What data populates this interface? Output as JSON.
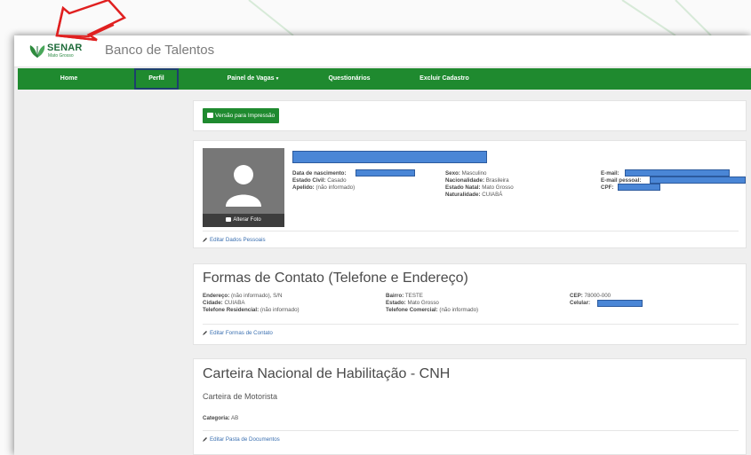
{
  "app": {
    "logo_text": "SENAR",
    "logo_sub": "Mato Grosso",
    "title": "Banco de Talentos"
  },
  "nav": {
    "items": [
      {
        "label": "Home"
      },
      {
        "label": "Perfil"
      },
      {
        "label": "Painel de Vagas"
      },
      {
        "label": "Questionários"
      },
      {
        "label": "Excluir Cadastro"
      }
    ]
  },
  "print": {
    "label": "Versão para Impressão"
  },
  "personal": {
    "photo_button": "Alterar Foto",
    "col1": [
      {
        "label": "Data de nascimento:",
        "value": ""
      },
      {
        "label": "Estado Civil:",
        "value": "Casado"
      },
      {
        "label": "Apelido:",
        "value": "(não informado)"
      }
    ],
    "col2": [
      {
        "label": "Sexo:",
        "value": "Masculino"
      },
      {
        "label": "Nacionalidade:",
        "value": "Brasileira"
      },
      {
        "label": "Estado Natal:",
        "value": "Mato Grosso"
      },
      {
        "label": "Naturalidade:",
        "value": "CUIABÁ"
      }
    ],
    "col3": [
      {
        "label": "E-mail:",
        "value": ""
      },
      {
        "label": "E-mail pessoal:",
        "value": ""
      },
      {
        "label": "CPF:",
        "value": ""
      }
    ],
    "edit_label": "Editar Dados Pessoais"
  },
  "contact": {
    "title": "Formas de Contato (Telefone e Endereço)",
    "col1": [
      {
        "label": "Endereço:",
        "value": "(não informado), S/N"
      },
      {
        "label": "Cidade:",
        "value": "CUIABA"
      },
      {
        "label": "Telefone Residencial:",
        "value": "(não informado)"
      }
    ],
    "col2": [
      {
        "label": "Bairro:",
        "value": "TESTE"
      },
      {
        "label": "Estado:",
        "value": "Mato Grosso"
      },
      {
        "label": "Telefone Comercial:",
        "value": "(não informado)"
      }
    ],
    "col3": [
      {
        "label": "CEP:",
        "value": "78000-000"
      },
      {
        "label": "Celular:",
        "value": ""
      }
    ],
    "edit_label": "Editar Formas de Contato"
  },
  "cnh": {
    "title": "Carteira Nacional de Habilitação - CNH",
    "subtitle": "Carteira de Motorista",
    "category_label": "Categoria:",
    "category_value": "AB",
    "edit_label": "Editar Pasta de Documentos"
  },
  "colors": {
    "nav_green": "#1f8a2f",
    "redaction_blue": "#4a86d6",
    "annotation_red": "#e02020"
  }
}
